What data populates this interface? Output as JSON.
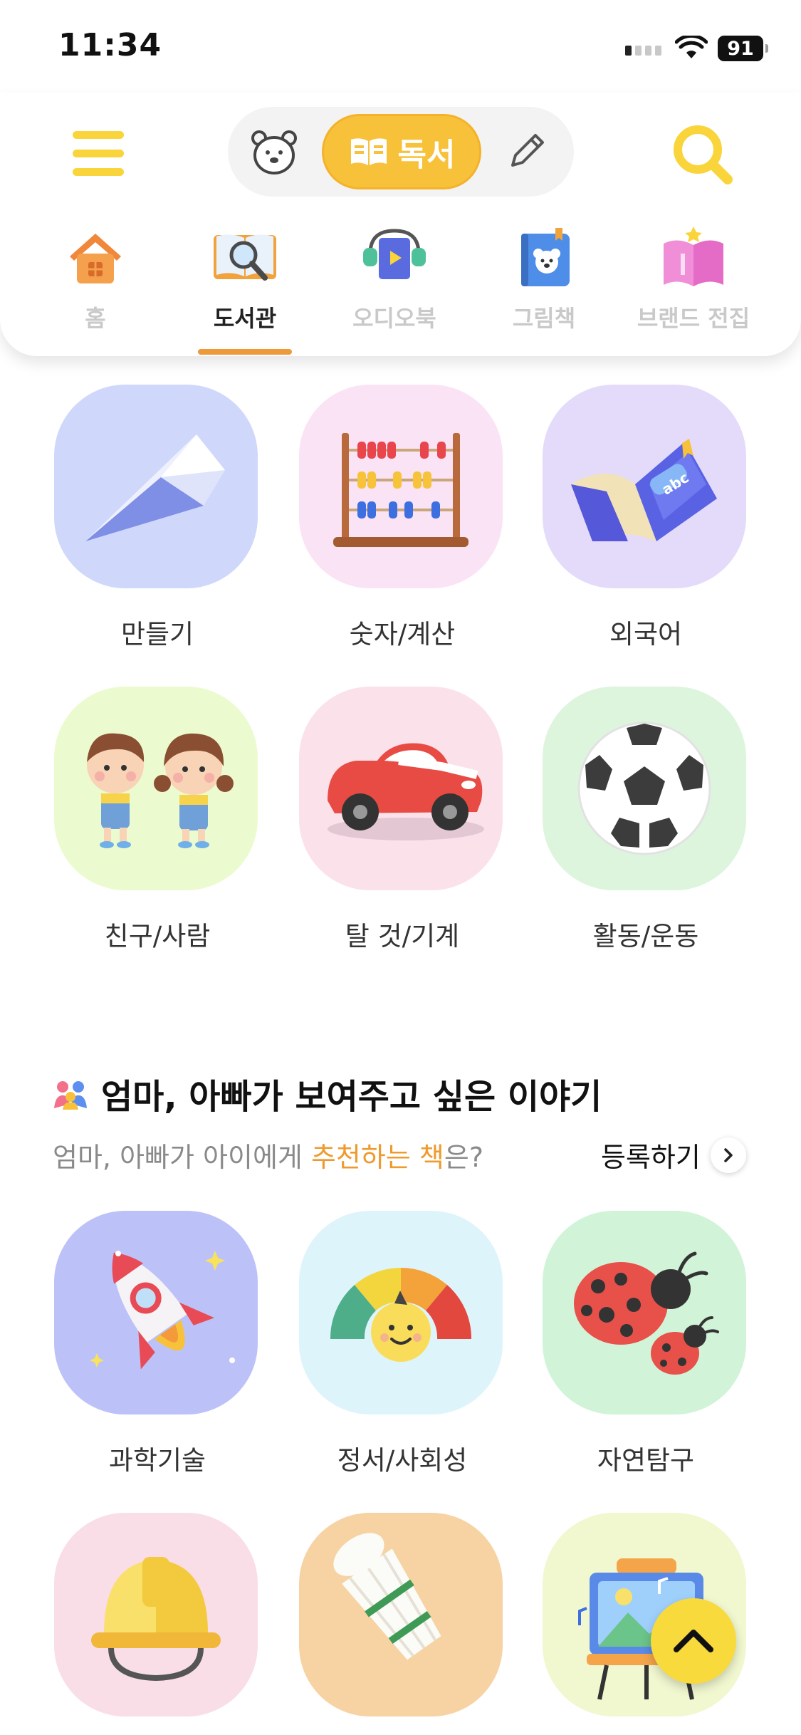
{
  "status_bar": {
    "time": "11:34",
    "battery": "91"
  },
  "header": {
    "mode_switch": {
      "read_label": "독서"
    },
    "tabs": [
      {
        "label": "홈",
        "icon": "house-icon"
      },
      {
        "label": "도서관",
        "icon": "library-book-icon",
        "active": true
      },
      {
        "label": "오디오북",
        "icon": "audiobook-icon"
      },
      {
        "label": "그림책",
        "icon": "picture-book-icon"
      },
      {
        "label": "브랜드 전집",
        "icon": "brand-collection-icon"
      }
    ]
  },
  "categories_top": [
    {
      "label": "만들기",
      "icon": "paper-plane-icon",
      "bg": "#cfd8fb"
    },
    {
      "label": "숫자/계산",
      "icon": "abacus-icon",
      "bg": "#fbe3f6"
    },
    {
      "label": "외국어",
      "icon": "abc-book-icon",
      "bg": "#e4dbfb"
    },
    {
      "label": "친구/사람",
      "icon": "friends-icon",
      "bg": "#ecfbcf"
    },
    {
      "label": "탈 것/기계",
      "icon": "car-icon",
      "bg": "#fbe1ea"
    },
    {
      "label": "활동/운동",
      "icon": "soccer-ball-icon",
      "bg": "#ddf5dd"
    }
  ],
  "section": {
    "title": "엄마, 아빠가 보여주고 싶은 이야기",
    "subtitle_pre": "엄마, 아빠가 아이에게 ",
    "subtitle_highlight": "추천하는 책",
    "subtitle_post": "은?",
    "register_label": "등록하기"
  },
  "categories_bottom": [
    {
      "label": "과학기술",
      "icon": "rocket-icon",
      "bg": "#bcc2f8"
    },
    {
      "label": "정서/사회성",
      "icon": "emotion-gauge-icon",
      "bg": "#def4fb"
    },
    {
      "label": "자연탐구",
      "icon": "ladybug-icon",
      "bg": "#d1f3d8"
    },
    {
      "label": "",
      "icon": "hard-hat-icon",
      "bg": "#f9dde7"
    },
    {
      "label": "",
      "icon": "shuttlecock-icon",
      "bg": "#f7d3a4"
    },
    {
      "label": "",
      "icon": "easel-painting-icon",
      "bg": "#f1f8d0"
    }
  ],
  "colors": {
    "accent": "#f7c23a",
    "highlight": "#ef9a2c",
    "underline": "#ee9a3b"
  }
}
